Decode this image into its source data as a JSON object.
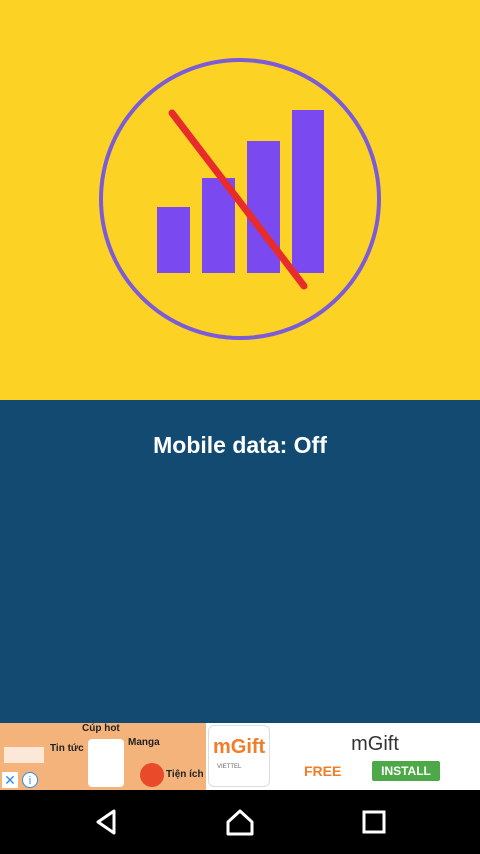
{
  "illustration": {
    "icon": "mobile-data-off-icon",
    "colors": {
      "background": "#FCD324",
      "bars": "#7A4AF0",
      "circle": "#7C5BD8",
      "strike": "#E82C2C"
    }
  },
  "status": {
    "text": "Mobile data: Off",
    "background": "#124A72"
  },
  "ad": {
    "collage_labels": [
      "Cúp hot",
      "Tin tức",
      "Manga",
      "Tiện ích"
    ],
    "logo_text": "mGift",
    "logo_sub": "VIETTEL",
    "title": "mGift",
    "price": "FREE",
    "install_label": "INSTALL",
    "close_icon": "close-icon",
    "info_icon": "info-icon"
  },
  "navbar": {
    "buttons": [
      "back-icon",
      "home-icon",
      "recents-icon"
    ]
  }
}
